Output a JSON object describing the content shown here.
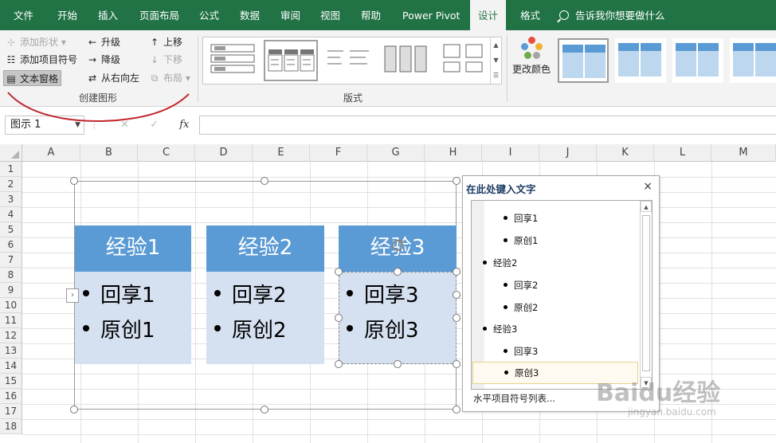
{
  "ribbon_tabs": [
    "文件",
    "开始",
    "插入",
    "页面布局",
    "公式",
    "数据",
    "审阅",
    "视图",
    "帮助",
    "Power Pivot",
    "设计",
    "格式"
  ],
  "active_tab": "设计",
  "tell_me": "告诉我你想要做什么",
  "create_graphic": {
    "add_shape": "添加形状",
    "add_bullet": "添加项目符号",
    "text_pane": "文本窗格",
    "promote": "升级",
    "demote": "降级",
    "right_to_left": "从右向左",
    "move_up": "上移",
    "move_down": "下移",
    "layout": "布局",
    "group_label": "创建图形"
  },
  "layouts_label": "版式",
  "change_colors": "更改颜色",
  "name_box": "图示 1",
  "fx_label": "fx",
  "columns": [
    "A",
    "B",
    "C",
    "D",
    "E",
    "F",
    "G",
    "H",
    "I",
    "J",
    "K",
    "L",
    "M"
  ],
  "rows": [
    "1",
    "2",
    "3",
    "4",
    "5",
    "6",
    "7",
    "8",
    "9",
    "10",
    "11",
    "12",
    "13",
    "14",
    "15",
    "16",
    "17",
    "18"
  ],
  "smartart": [
    {
      "title": "经验1",
      "items": [
        "回享1",
        "原创1"
      ]
    },
    {
      "title": "经验2",
      "items": [
        "回享2",
        "原创2"
      ]
    },
    {
      "title": "经验3",
      "items": [
        "回享3",
        "原创3"
      ]
    }
  ],
  "text_pane": {
    "title": "在此处键入文字",
    "close": "×",
    "items": [
      {
        "text": "回享1",
        "level": 2
      },
      {
        "text": "原创1",
        "level": 2
      },
      {
        "text": "经验2",
        "level": 1
      },
      {
        "text": "回享2",
        "level": 2
      },
      {
        "text": "原创2",
        "level": 2
      },
      {
        "text": "经验3",
        "level": 1
      },
      {
        "text": "回享3",
        "level": 2
      },
      {
        "text": "原创3",
        "level": 2
      }
    ],
    "footer_link": "水平项目符号列表..."
  },
  "watermark": {
    "brand": "Baidu经验",
    "url": "jingyan.baidu.com"
  },
  "colors": {
    "excel_green": "#217346",
    "smartart_header": "#5b9bd5",
    "smartart_body": "#d5e0f0",
    "annotation": "#c0282d"
  }
}
